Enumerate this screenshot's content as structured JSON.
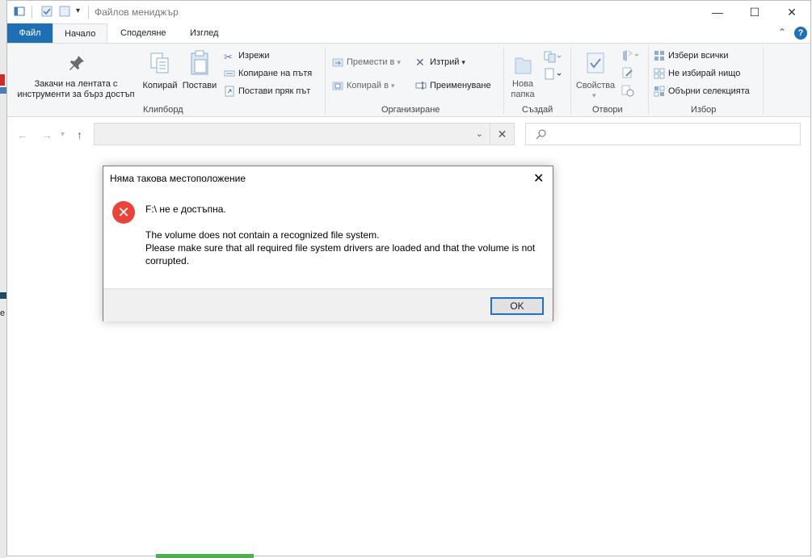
{
  "window": {
    "title": "Файлов мениджър",
    "minimize_glyph": "—",
    "maximize_glyph": "☐",
    "close_glyph": "✕"
  },
  "tabs": [
    {
      "label": "Файл"
    },
    {
      "label": "Начало"
    },
    {
      "label": "Споделяне"
    },
    {
      "label": "Изглед"
    }
  ],
  "ribbon": {
    "clipboard": {
      "pin_label_1": "Закачи на лентата с",
      "pin_label_2": "инструменти за бърз достъп",
      "copy": "Копирай",
      "paste": "Постави",
      "cut": "Изрежи",
      "copy_path": "Копиране на пътя",
      "paste_shortcut": "Постави пряк път",
      "group": "Клипборд"
    },
    "organize": {
      "move_to": "Премести в",
      "copy_to": "Копирай в",
      "delete": "Изтрий",
      "rename": "Преименуване",
      "group": "Организиране"
    },
    "new": {
      "new_folder_1": "Нова",
      "new_folder_2": "папка",
      "group": "Създай"
    },
    "open": {
      "properties": "Свойства",
      "group": "Отвори"
    },
    "select": {
      "select_all": "Избери всички",
      "select_none": "Не избирай нищо",
      "invert": "Обърни селекцията",
      "group": "Избор"
    }
  },
  "dialog": {
    "title": "Няма такова местоположение",
    "heading": "F:\\ не е достъпна.",
    "line1": "The volume does not contain a recognized file system.",
    "line2": "Please make sure that all required file system drivers are loaded and that the volume is not corrupted.",
    "ok": "OK",
    "close_glyph": "✕"
  },
  "desktop": {
    "edge_text": "e"
  },
  "colors": {
    "accent": "#1f6fb5",
    "error": "#e8443a",
    "button_focus": "#1c73cf"
  }
}
